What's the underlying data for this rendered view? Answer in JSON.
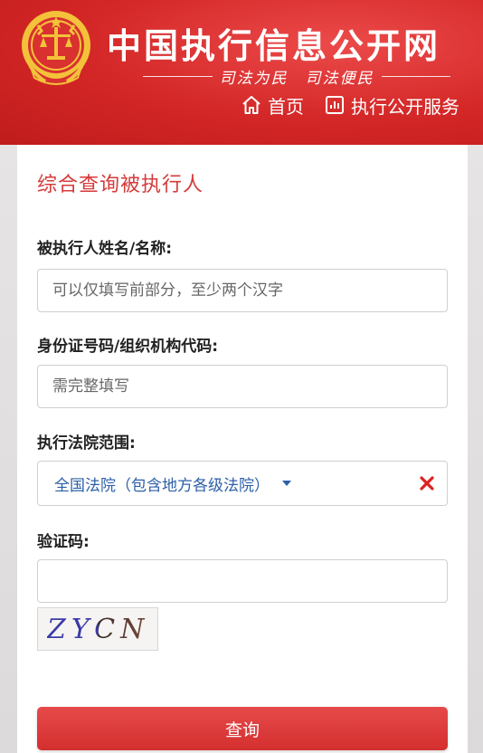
{
  "header": {
    "site_title": "中国执行信息公开网",
    "slogan": "司法为民　司法便民",
    "nav": [
      {
        "label": "首页",
        "icon": "home-icon"
      },
      {
        "label": "执行公开服务",
        "icon": "chart-icon"
      }
    ]
  },
  "form": {
    "title": "综合查询被执行人",
    "name_label": "被执行人姓名/名称:",
    "name_placeholder": "可以仅填写前部分，至少两个汉字",
    "name_value": "",
    "id_label": "身份证号码/组织机构代码:",
    "id_placeholder": "需完整填写",
    "id_value": "",
    "court_label": "执行法院范围:",
    "court_selected": "全国法院（包含地方各级法院）",
    "captcha_label": "验证码:",
    "captcha_value": "",
    "captcha_image_text": "ZYCN",
    "submit_label": "查询"
  },
  "colors": {
    "brand_red": "#d32626",
    "title_red": "#d63a3a",
    "select_blue": "#2c5fa8",
    "clear_red": "#e02020"
  }
}
